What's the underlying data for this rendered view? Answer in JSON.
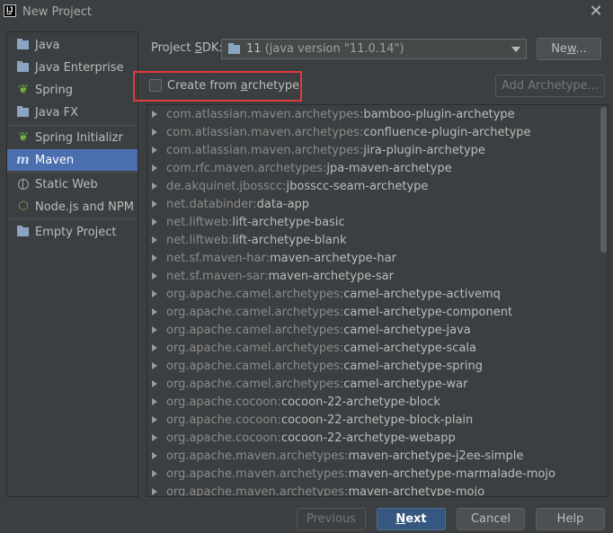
{
  "window": {
    "title": "New Project",
    "icon_letters": "IJ"
  },
  "sidebar": {
    "items": [
      {
        "label": "Java",
        "icon": "folder-icon"
      },
      {
        "label": "Java Enterprise",
        "icon": "folder-icon"
      },
      {
        "label": "Spring",
        "icon": "spring-leaf-icon"
      },
      {
        "label": "Java FX",
        "icon": "folder-icon"
      },
      {
        "label": "Spring Initializr",
        "icon": "spring-initializr-icon"
      },
      {
        "label": "Maven",
        "icon": "maven-icon",
        "selected": true
      },
      {
        "label": "Static Web",
        "icon": "globe-icon"
      },
      {
        "label": "Node.js and NPM",
        "icon": "nodejs-icon"
      },
      {
        "label": "Empty Project",
        "icon": "folder-icon"
      }
    ]
  },
  "sdk": {
    "label_pre": "Project ",
    "label_mnemonic": "S",
    "label_post": "DK:",
    "value": "11",
    "version": "(java version \"11.0.14\")",
    "new_button": {
      "pre": "Ne",
      "mnemonic": "w",
      "post": "..."
    }
  },
  "archetype": {
    "checkbox_pre": "Create from ",
    "checkbox_mnemonic": "a",
    "checkbox_post": "rchetype",
    "checked": false,
    "add_button": "Add Archetype..."
  },
  "archetypes": [
    {
      "group": "com.atlassian.maven.archetypes:",
      "artifact": "bamboo-plugin-archetype"
    },
    {
      "group": "com.atlassian.maven.archetypes:",
      "artifact": "confluence-plugin-archetype"
    },
    {
      "group": "com.atlassian.maven.archetypes:",
      "artifact": "jira-plugin-archetype"
    },
    {
      "group": "com.rfc.maven.archetypes:",
      "artifact": "jpa-maven-archetype"
    },
    {
      "group": "de.akquinet.jbosscc:",
      "artifact": "jbosscc-seam-archetype"
    },
    {
      "group": "net.databinder:",
      "artifact": "data-app"
    },
    {
      "group": "net.liftweb:",
      "artifact": "lift-archetype-basic"
    },
    {
      "group": "net.liftweb:",
      "artifact": "lift-archetype-blank"
    },
    {
      "group": "net.sf.maven-har:",
      "artifact": "maven-archetype-har"
    },
    {
      "group": "net.sf.maven-sar:",
      "artifact": "maven-archetype-sar"
    },
    {
      "group": "org.apache.camel.archetypes:",
      "artifact": "camel-archetype-activemq"
    },
    {
      "group": "org.apache.camel.archetypes:",
      "artifact": "camel-archetype-component"
    },
    {
      "group": "org.apache.camel.archetypes:",
      "artifact": "camel-archetype-java"
    },
    {
      "group": "org.apache.camel.archetypes:",
      "artifact": "camel-archetype-scala"
    },
    {
      "group": "org.apache.camel.archetypes:",
      "artifact": "camel-archetype-spring"
    },
    {
      "group": "org.apache.camel.archetypes:",
      "artifact": "camel-archetype-war"
    },
    {
      "group": "org.apache.cocoon:",
      "artifact": "cocoon-22-archetype-block"
    },
    {
      "group": "org.apache.cocoon:",
      "artifact": "cocoon-22-archetype-block-plain"
    },
    {
      "group": "org.apache.cocoon:",
      "artifact": "cocoon-22-archetype-webapp"
    },
    {
      "group": "org.apache.maven.archetypes:",
      "artifact": "maven-archetype-j2ee-simple"
    },
    {
      "group": "org.apache.maven.archetypes:",
      "artifact": "maven-archetype-marmalade-mojo"
    },
    {
      "group": "org.apache.maven.archetypes:",
      "artifact": "maven-archetype-mojo"
    }
  ],
  "footer": {
    "previous": "Previous",
    "next_mnemonic": "N",
    "next_post": "ext",
    "cancel": "Cancel",
    "help": "Help"
  },
  "colors": {
    "background": "#3c3f41",
    "selection": "#4b6eaf",
    "primary_button": "#365880",
    "highlight_border": "#e03a3a"
  }
}
